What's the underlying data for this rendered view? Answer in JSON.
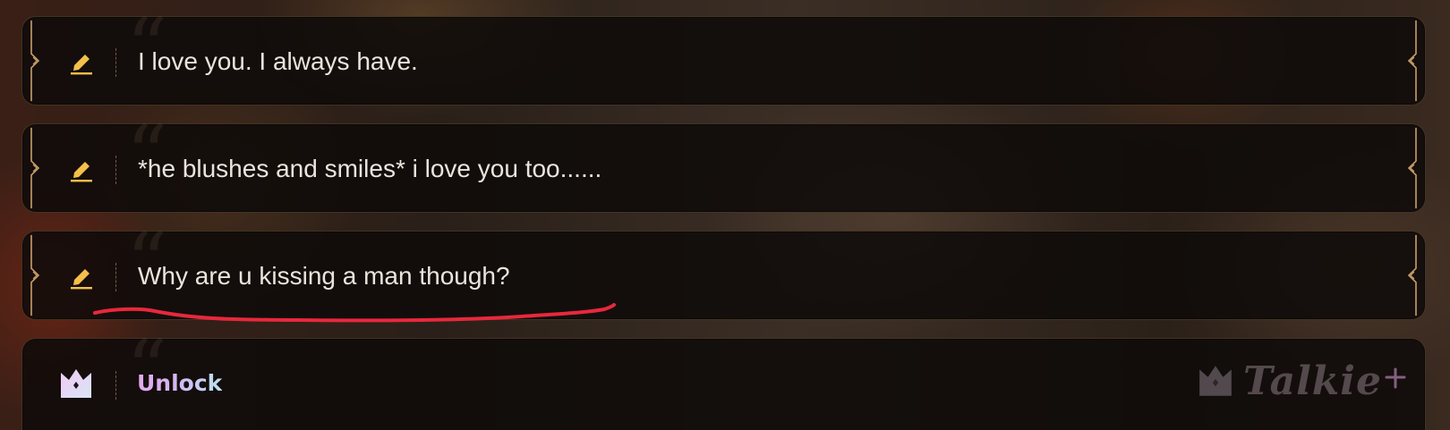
{
  "messages": [
    {
      "text": "I love you. I always have.",
      "edit_icon": "pencil-icon"
    },
    {
      "text": "*he blushes and smiles* i love you too......",
      "edit_icon": "pencil-icon"
    },
    {
      "text": "Why are u kissing a man though?",
      "edit_icon": "pencil-icon"
    }
  ],
  "unlock": {
    "label": "Unlock",
    "icon": "crown-icon"
  },
  "brand": {
    "name": "Talkie",
    "icon": "crown-icon",
    "suffix_icon": "plus-icon"
  },
  "annotation": {
    "color": "#e8283c"
  },
  "colors": {
    "accent": "#f5c04a",
    "text": "#ebe4dc",
    "border": "#be9664"
  }
}
